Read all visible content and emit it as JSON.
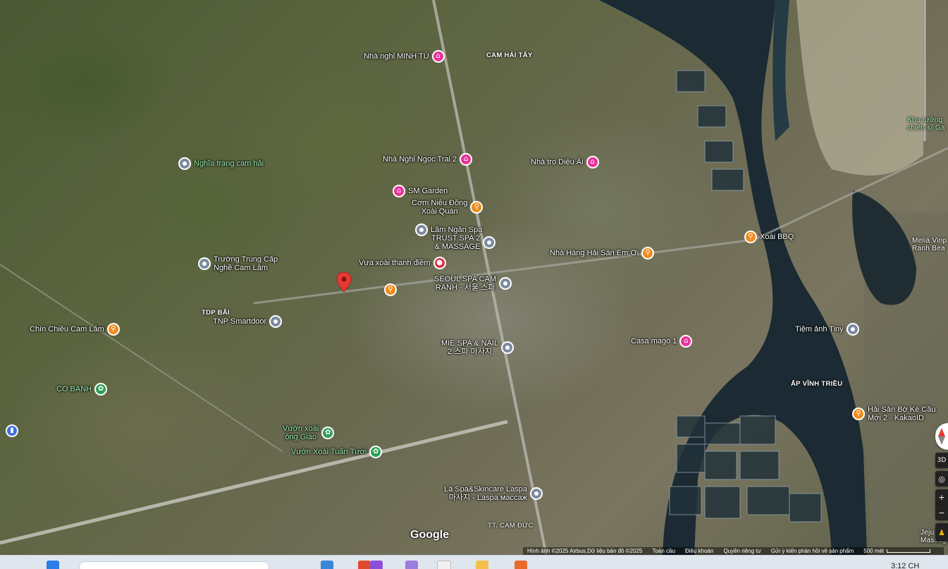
{
  "map": {
    "markers": [
      {
        "id": "nha-nghi-minh-tu",
        "label": "Nhà nghỉ MINH TÚ",
        "type": "hotel"
      },
      {
        "id": "nha-nghi-ngoc-trai-2",
        "label": "Nhà Nghỉ Ngọc Trai 2",
        "type": "hotel"
      },
      {
        "id": "nha-tro-dieu-ai",
        "label": "Nhà trọ Diệu Ái",
        "type": "hotel"
      },
      {
        "id": "sm-garden",
        "label": "SM Garden",
        "type": "hotel"
      },
      {
        "id": "com-nieu-dong-xoai-quan",
        "label": "Cơm Niêu Đồng\nXoài Quán",
        "type": "food"
      },
      {
        "id": "lam-ngan-spa",
        "label": "Lâm Ngân Spa",
        "type": "place"
      },
      {
        "id": "trust-spa-2",
        "label": "TRUST SPA 2\n& MASSAGE",
        "type": "place"
      },
      {
        "id": "nha-hang-hai-san-em-oi",
        "label": "Nhà Hàng Hải Sản Em Ơi",
        "type": "food"
      },
      {
        "id": "xoai-bbq",
        "label": "Xoài BBQ",
        "type": "food"
      },
      {
        "id": "truong-trung-cap",
        "label": "Trường Trung Cấp\nNghề Cam Lâm",
        "type": "place"
      },
      {
        "id": "vua-xoai-thanh-diem",
        "label": "Vựa xoài thanh điềm",
        "type": "shop"
      },
      {
        "id": "seoul-spa",
        "label": "SEOUL SPA CAM\nRANH - 서울 스파",
        "type": "place"
      },
      {
        "id": "tnp-smartdoor",
        "label": "TNP Smartdoor",
        "type": "place"
      },
      {
        "id": "chin-chieu-cam-lam",
        "label": "Chín Chiều Cam Lâm",
        "type": "food"
      },
      {
        "id": "mie-spa-nail",
        "label": "MIE SPA & NAIL\n2 스파 마사지",
        "type": "place"
      },
      {
        "id": "casa-mago-1",
        "label": "Casa mago 1",
        "type": "hotel"
      },
      {
        "id": "tiem-anh-tiny",
        "label": "Tiệm ảnh Tiny",
        "type": "place"
      },
      {
        "id": "co-banh",
        "label": "CO BANH",
        "type": "park"
      },
      {
        "id": "hai-san-bo-ke",
        "label": "Hải Sản Bờ Kè Cầu\nMới 2 - KakaoID",
        "type": "food"
      },
      {
        "id": "vuon-xoai-ong-giao",
        "label": "Vườn xoài\nông Giáo",
        "type": "park"
      },
      {
        "id": "vuon-xoai-tuan-tuoi",
        "label": "Vườn Xoài Tuấn Tươi",
        "type": "park"
      },
      {
        "id": "la-spa",
        "label": "Là Spa&Skincare Laspa\n마사지 - Laspa массаж",
        "type": "place"
      },
      {
        "id": "nghia-trang-cam-hai",
        "label": "Nghĩa trang cam hải",
        "type": "place"
      },
      {
        "id": "unnamed-food",
        "label": "",
        "type": "food"
      }
    ],
    "areas": [
      {
        "id": "cam-hai-tay",
        "label": "CAM HẢI TÂY"
      },
      {
        "id": "tdp-bai",
        "label": "TDP BÃI"
      },
      {
        "id": "ap-vinh-trieu",
        "label": "ẤP VĨNH TRIỀU"
      },
      {
        "id": "tt-cam-duc",
        "label": "TT. CAM ĐỨC"
      },
      {
        "id": "khu-tuong-niem",
        "label": "Khu tưởng\nchiến sĩ Ga"
      },
      {
        "id": "melia",
        "label": "Meliá Vinp\nRanh Bea"
      },
      {
        "id": "jeju",
        "label": "Jeju\nMassag"
      }
    ],
    "google_logo": "Google",
    "attribution": [
      "Hình ảnh ©2025 Airbus,Dữ liệu bản đồ ©2025",
      "Toàn cầu",
      "Điều khoản",
      "Quyền riêng tư",
      "Gửi ý kiến phản hồi về sản phẩm"
    ],
    "scale_label": "500 mét",
    "controls": {
      "three_d": "3D"
    }
  },
  "taskbar": {
    "clock": "3:12 CH"
  },
  "colors": {
    "hotel": "#e8339a",
    "food": "#f08a1c",
    "place": "#7b8aa0",
    "park": "#2f9e58",
    "shop": "#d8374a",
    "water": "#1b2a33",
    "road": "#b8b8b0"
  }
}
